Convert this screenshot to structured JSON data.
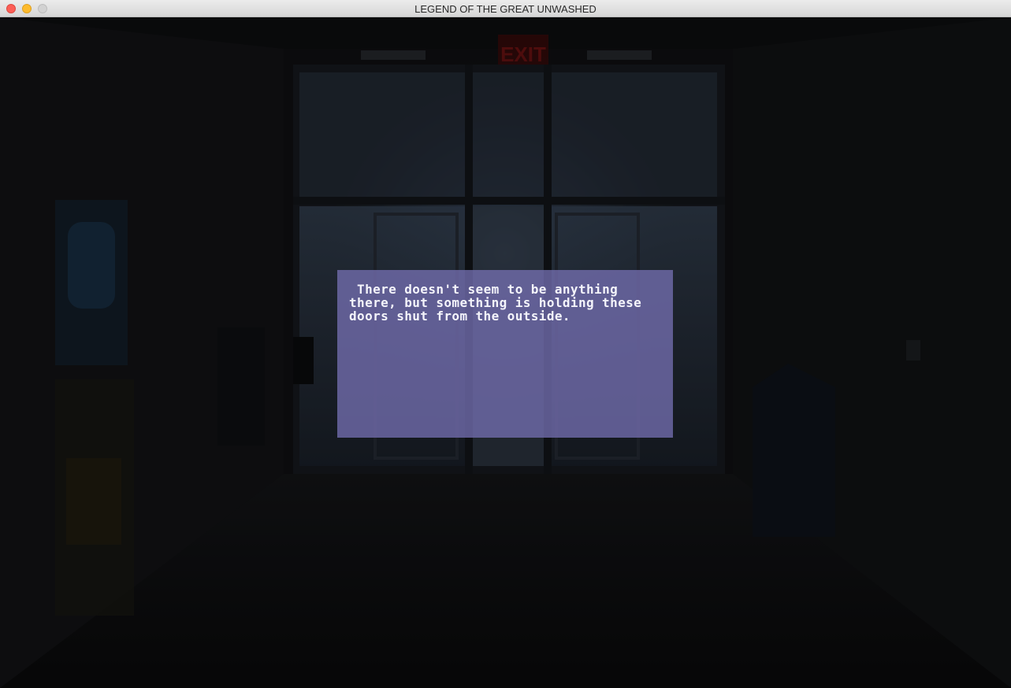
{
  "window": {
    "title": "LEGEND OF THE GREAT UNWASHED",
    "controls": [
      "close-icon",
      "minimize-icon",
      "zoom-icon"
    ]
  },
  "scene": {
    "sign_text": "EXIT"
  },
  "dialog": {
    "text": " There doesn't seem to be anything there, but something is holding these doors shut from the outside."
  },
  "colors": {
    "dialog_background": "#736eaf",
    "dialog_text": "#f4f4fb",
    "exit_sign": "#7a1414"
  }
}
